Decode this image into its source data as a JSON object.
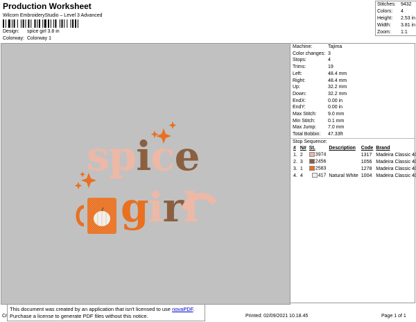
{
  "header": {
    "title": "Production Worksheet",
    "subtitle": "Wilcom EmbroideryStudio – Level 3 Advanced",
    "design_label": "Design:",
    "design_value": "spice girl 3.8 in",
    "colorway_label": "Colorway:",
    "colorway_value": "Colorway 1"
  },
  "stats": {
    "stitches_label": "Stitches:",
    "stitches": "9432",
    "colors_label": "Colors:",
    "colors": "4",
    "height_label": "Height:",
    "height": "2.53 in",
    "width_label": "Width:",
    "width": "3.81 in",
    "zoom_label": "Zoom:",
    "zoom": "1:1"
  },
  "machine": [
    {
      "label": "Machine:",
      "value": "Tajima"
    },
    {
      "label": "Color changes:",
      "value": "3"
    },
    {
      "label": "Stops:",
      "value": "4"
    },
    {
      "label": "Trims:",
      "value": "19"
    },
    {
      "label": "Left:",
      "value": "48.4 mm"
    },
    {
      "label": "Right:",
      "value": "48.4 mm"
    },
    {
      "label": "Up:",
      "value": "32.2 mm"
    },
    {
      "label": "Down:",
      "value": "32.2 mm"
    },
    {
      "label": "EndX:",
      "value": "0.00 in"
    },
    {
      "label": "EndY:",
      "value": "0.00 in"
    },
    {
      "label": "Max Stitch:",
      "value": "9.0 mm"
    },
    {
      "label": "Min Stitch:",
      "value": "0.1 mm"
    },
    {
      "label": "Max Jump:",
      "value": "7.0 mm"
    },
    {
      "label": "Total Bobbin:",
      "value": "47.33ft"
    }
  ],
  "stop_sequence": {
    "heading": "Stop Sequence:",
    "columns": [
      "#",
      "N#",
      "St.",
      "Description",
      "Code",
      "Brand"
    ],
    "rows": [
      {
        "num": "1.",
        "n": "2",
        "color": "#eeb8a6",
        "st": "3974",
        "desc": "",
        "code": "1317",
        "brand": "Madeira Classic 40"
      },
      {
        "num": "2.",
        "n": "3",
        "color": "#8a6040",
        "st": "2456",
        "desc": "",
        "code": "1056",
        "brand": "Madeira Classic 40"
      },
      {
        "num": "3.",
        "n": "1",
        "color": "#e87020",
        "st": "2583",
        "desc": "",
        "code": "1278",
        "brand": "Madeira Classic 40"
      },
      {
        "num": "4.",
        "n": "4",
        "color": "#f4efe6",
        "st": "417",
        "desc": "Natural White",
        "code": "1004",
        "brand": "Madeira Classic 40"
      }
    ]
  },
  "notice": {
    "line1_pre": "This document was created by an application that isn't licensed to use ",
    "link": "novaPDF",
    "line1_post": ".",
    "line2": "Purchase a license to generate PDF files without this notice."
  },
  "footer": {
    "left": "Cr",
    "printed": "Printed: 02/09/2021 10.18.45",
    "page": "Page 1 of 1"
  },
  "design": {
    "word1": "spice",
    "word2": "girl",
    "colors": {
      "pink": "#eeb8a6",
      "brown": "#8a6040",
      "orange": "#e87020",
      "white": "#f4efe6"
    }
  }
}
